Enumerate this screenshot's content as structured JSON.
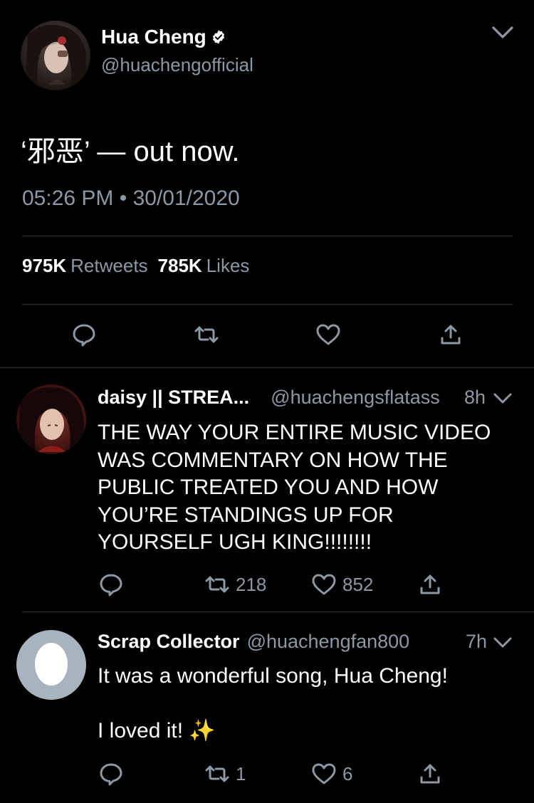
{
  "tweet": {
    "author": {
      "name": "Hua Cheng",
      "handle": "@huachengofficial",
      "verified": true
    },
    "text": "‘邪恶’ — out now.",
    "timestamp": "05:26 PM • 30/01/2020",
    "stats": {
      "retweets_count": "975K",
      "retweets_label": "Retweets",
      "likes_count": "785K",
      "likes_label": "Likes"
    },
    "actions": [
      "reply-icon",
      "retweet-icon",
      "like-icon",
      "share-icon"
    ]
  },
  "replies": [
    {
      "name": "daisy || STREA...",
      "handle": "@huachengsflatass",
      "time": "8h",
      "text_lines": [
        "THE WAY YOUR ENTIRE MUSIC VIDEO",
        "WAS COMMENTARY ON HOW THE",
        "PUBLIC TREATED YOU AND HOW",
        "YOU’RE STANDINGS UP FOR",
        "YOURSELF UGH KING!!!!!!!!"
      ],
      "retweets": "218",
      "likes": "852"
    },
    {
      "name": "Scrap Collector",
      "handle": "@huachengfan800",
      "time": "7h",
      "text_lines": [
        "It was a wonderful song, Hua Cheng!",
        "",
        "I loved it! ✨"
      ],
      "retweets": "1",
      "likes": "6"
    }
  ],
  "colors": {
    "background": "#000000",
    "text": "#ffffff",
    "secondary": "#8b98a5",
    "divider": "#2f3336",
    "verified_badge": "#ffffff"
  }
}
